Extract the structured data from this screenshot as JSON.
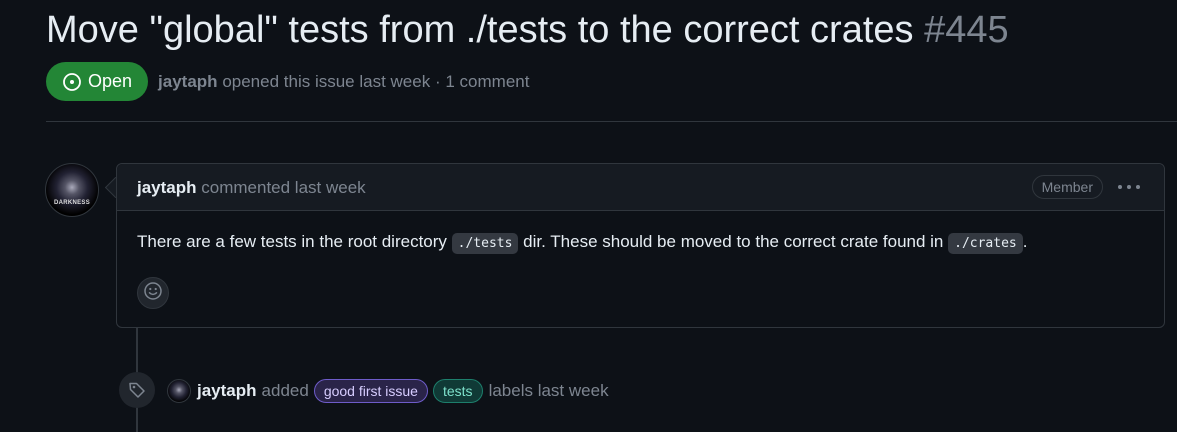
{
  "issue": {
    "title": "Move \"global\" tests from ./tests to the correct crates",
    "number": "#445",
    "state": "Open",
    "author": "jaytaph",
    "opened_text": "opened this issue last week",
    "separator": "·",
    "comments_text": "1 comment"
  },
  "comment": {
    "avatar_text": "DARKNESS",
    "author": "jaytaph",
    "action": "commented last week",
    "role_badge": "Member",
    "body_part1": "There are a few tests in the root directory ",
    "code1": "./tests",
    "body_part2": " dir. These should be moved to the correct crate found in ",
    "code2": "./crates",
    "body_part3": "."
  },
  "event": {
    "author": "jaytaph",
    "verb": "added",
    "labels": [
      "good first issue",
      "tests"
    ],
    "tail": "labels last week"
  },
  "colors": {
    "background": "#0d1117",
    "open_badge": "#238636",
    "border": "#30363d",
    "muted": "#7d8590"
  },
  "icons": [
    "issue-open-icon",
    "kebab-menu-icon",
    "smiley-icon",
    "tag-icon"
  ]
}
